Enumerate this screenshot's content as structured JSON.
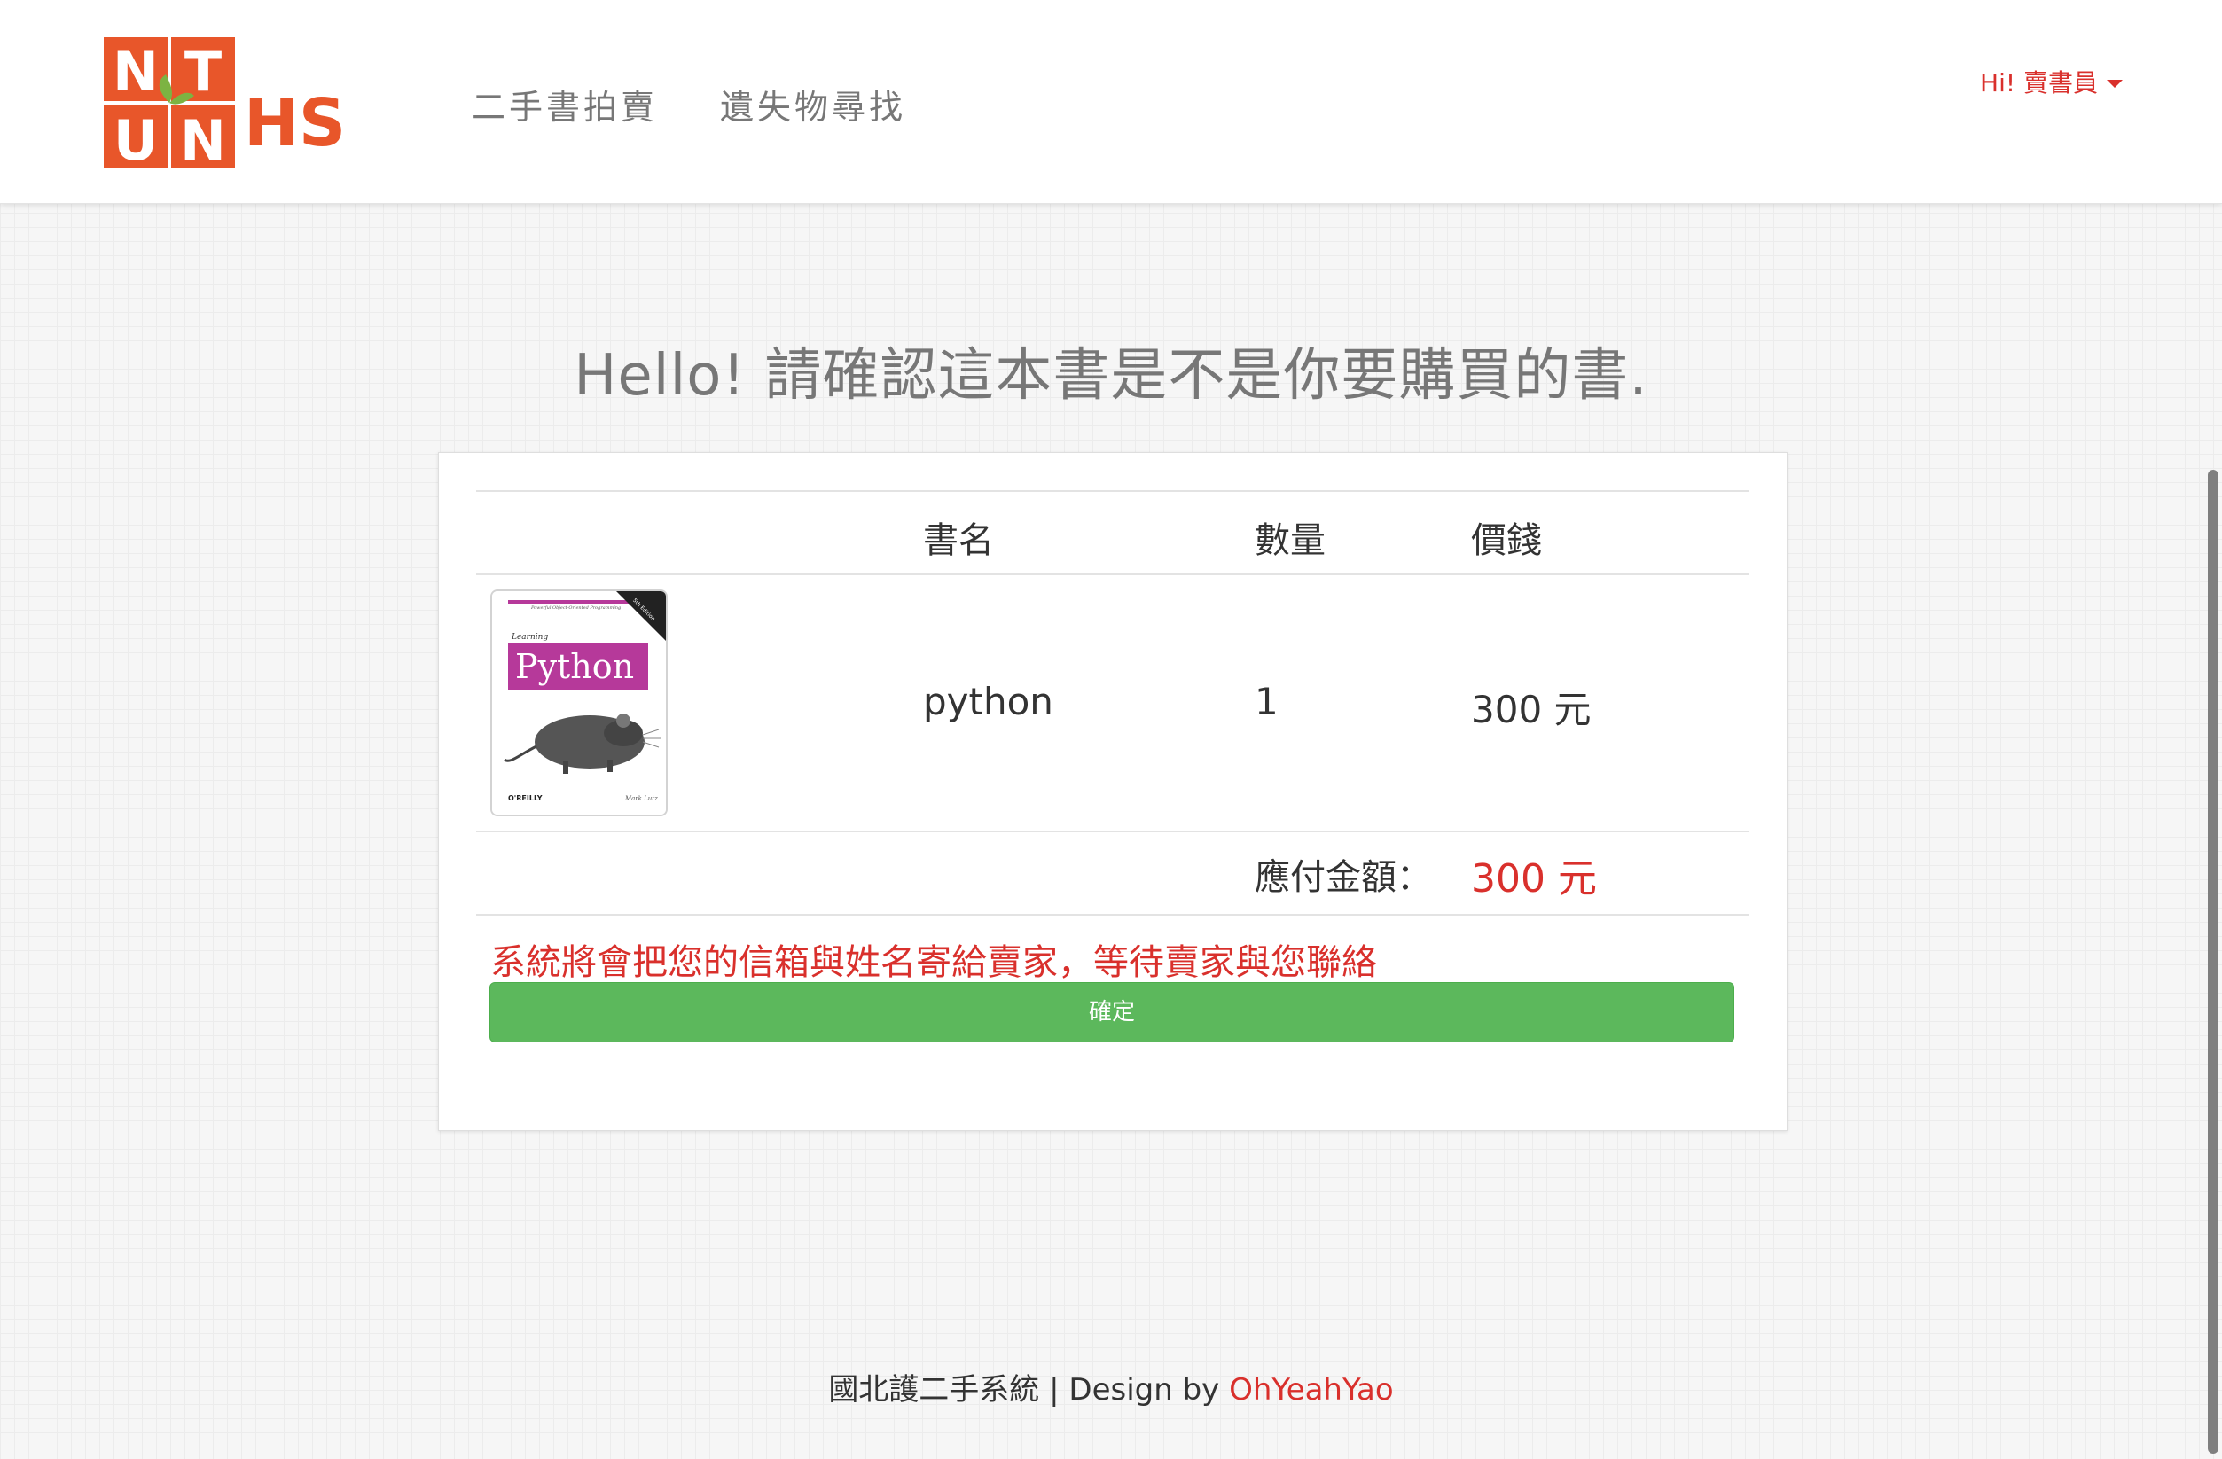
{
  "brand": {
    "logo_letters": [
      "N",
      "T",
      "U",
      "N"
    ],
    "logo_suffix": "HS",
    "accent_color": "#e8562a",
    "leaf_color": "#7cb342"
  },
  "nav": {
    "links": [
      "二手書拍賣",
      "遺失物尋找"
    ],
    "user_menu_label": "Hi! 賣書員"
  },
  "page": {
    "title": "Hello! 請確認這本書是不是你要購買的書."
  },
  "order_table": {
    "headers": {
      "name": "書名",
      "qty": "數量",
      "price": "價錢"
    },
    "item": {
      "cover_icon": "book-cover-python-icon",
      "cover_texts": {
        "top": "Powerful Object-Oriented Programming",
        "series": "Learning",
        "title": "Python",
        "publisher": "O'REILLY",
        "author": "Mark Lutz",
        "edition": "5th Edition"
      },
      "name": "python",
      "qty": "1",
      "price": "300 元"
    },
    "total_label": "應付金額：",
    "total_value": "300 元"
  },
  "notice": "系統將會把您的信箱與姓名寄給賣家，等待賣家與您聯絡",
  "confirm_button": "確定",
  "footer": {
    "text": "國北護二手系統 | Design by ",
    "author": "OhYeahYao"
  },
  "colors": {
    "accent_red": "#d9302c",
    "button_green": "#5cb85c",
    "cover_magenta": "#b6399a"
  }
}
